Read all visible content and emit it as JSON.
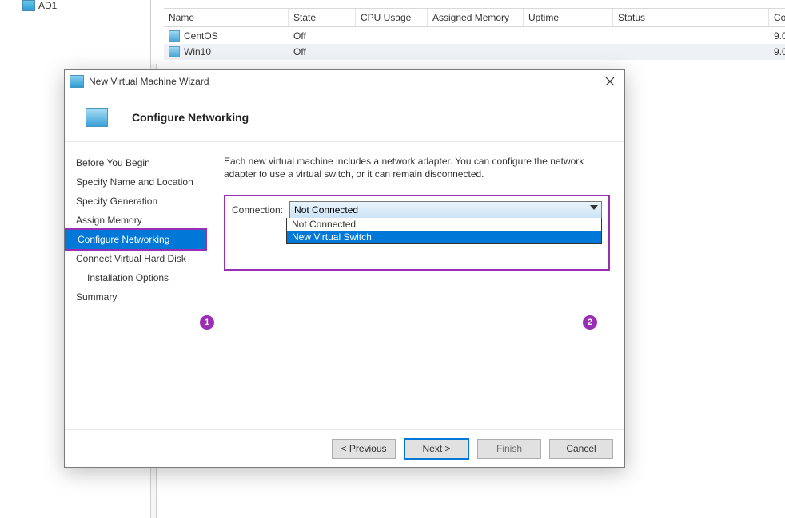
{
  "tree": {
    "node": "AD1"
  },
  "vm_table": {
    "headers": {
      "name": "Name",
      "state": "State",
      "cpu": "CPU Usage",
      "memory": "Assigned Memory",
      "uptime": "Uptime",
      "status": "Status",
      "co": "Co"
    },
    "rows": [
      {
        "name": "CentOS",
        "state": "Off",
        "co": "9.0"
      },
      {
        "name": "Win10",
        "state": "Off",
        "co": "9.0"
      }
    ]
  },
  "wizard": {
    "title": "New Virtual Machine Wizard",
    "heading": "Configure Networking",
    "steps": [
      "Before You Begin",
      "Specify Name and Location",
      "Specify Generation",
      "Assign Memory",
      "Configure Networking",
      "Connect Virtual Hard Disk",
      "Installation Options",
      "Summary"
    ],
    "description": "Each new virtual machine includes a network adapter. You can configure the network adapter to use a virtual switch, or it can remain disconnected.",
    "connection": {
      "label": "Connection:",
      "selected": "Not Connected",
      "options": [
        "Not Connected",
        "New Virtual Switch"
      ]
    },
    "buttons": {
      "prev": "< Previous",
      "next": "Next >",
      "finish": "Finish",
      "cancel": "Cancel"
    }
  },
  "annotations": {
    "b1": "1",
    "b2": "2"
  }
}
